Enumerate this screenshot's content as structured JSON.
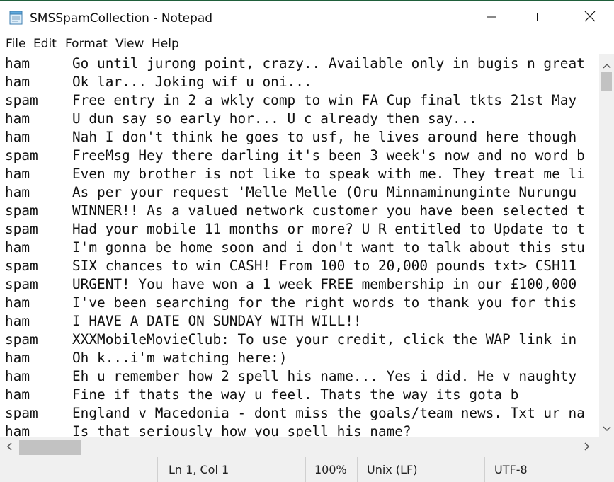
{
  "window": {
    "title": "SMSSpamCollection - Notepad",
    "icons": {
      "app": "notepad-icon",
      "minimize": "minimize-icon",
      "maximize": "maximize-icon",
      "close": "close-icon"
    }
  },
  "menu": [
    "File",
    "Edit",
    "Format",
    "View",
    "Help"
  ],
  "editor": {
    "lines": [
      {
        "label": "ham",
        "text": "Go until jurong point, crazy.. Available only in bugis n great"
      },
      {
        "label": "ham",
        "text": "Ok lar... Joking wif u oni..."
      },
      {
        "label": "spam",
        "text": "Free entry in 2 a wkly comp to win FA Cup final tkts 21st May"
      },
      {
        "label": "ham",
        "text": "U dun say so early hor... U c already then say..."
      },
      {
        "label": "ham",
        "text": "Nah I don't think he goes to usf, he lives around here though"
      },
      {
        "label": "spam",
        "text": "FreeMsg Hey there darling it's been 3 week's now and no word b"
      },
      {
        "label": "ham",
        "text": "Even my brother is not like to speak with me. They treat me li"
      },
      {
        "label": "ham",
        "text": "As per your request 'Melle Melle (Oru Minnaminunginte Nurungu"
      },
      {
        "label": "spam",
        "text": "WINNER!! As a valued network customer you have been selected t"
      },
      {
        "label": "spam",
        "text": "Had your mobile 11 months or more? U R entitled to Update to t"
      },
      {
        "label": "ham",
        "text": "I'm gonna be home soon and i don't want to talk about this stu"
      },
      {
        "label": "spam",
        "text": "SIX chances to win CASH! From 100 to 20,000 pounds txt> CSH11"
      },
      {
        "label": "spam",
        "text": "URGENT! You have won a 1 week FREE membership in our £100,000"
      },
      {
        "label": "ham",
        "text": "I've been searching for the right words to thank you for this"
      },
      {
        "label": "ham",
        "text": "I HAVE A DATE ON SUNDAY WITH WILL!!"
      },
      {
        "label": "spam",
        "text": "XXXMobileMovieClub: To use your credit, click the WAP link in"
      },
      {
        "label": "ham",
        "text": "Oh k...i'm watching here:)"
      },
      {
        "label": "ham",
        "text": "Eh u remember how 2 spell his name... Yes i did. He v naughty"
      },
      {
        "label": "ham",
        "text": "Fine if thats the way u feel. Thats the way its gota b"
      },
      {
        "label": "spam",
        "text": "England v Macedonia - dont miss the goals/team news. Txt ur na"
      },
      {
        "label": "ham",
        "text": "Is that seriously how you spell his name?"
      }
    ]
  },
  "status": {
    "position": "Ln 1, Col 1",
    "zoom": "100%",
    "line_ending": "Unix (LF)",
    "encoding": "UTF-8"
  }
}
